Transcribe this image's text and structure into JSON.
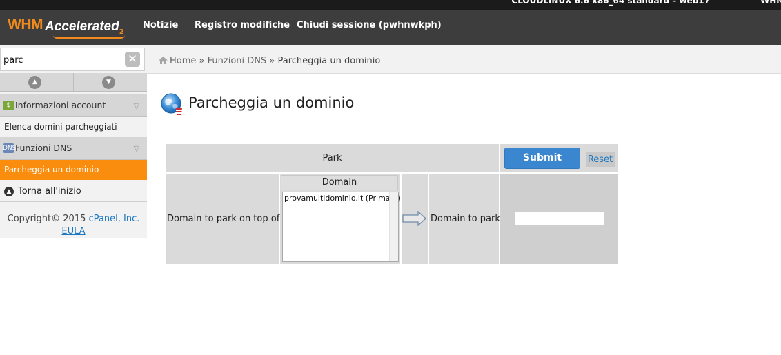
{
  "top_strip": {
    "server_text": "CLOUDLINUX 6.6 x86_64 standard – web17",
    "whm_text": "WHM"
  },
  "header": {
    "logo": {
      "whm": "WHM",
      "accelerated": "Accelerated",
      "version": "2"
    },
    "nav": [
      "Notizie",
      "Registro modifiche",
      "Chiudi sessione (pwhnwkph)"
    ]
  },
  "sidebar": {
    "search_value": "parc",
    "categories": [
      {
        "label": "Informazioni account",
        "icon": "account-info-icon"
      },
      {
        "label": "Funzioni DNS",
        "icon": "dns-icon"
      }
    ],
    "items": [
      "Elenca domini parcheggiati",
      "Parcheggia un dominio"
    ],
    "back_to_top": "Torna all'inizio",
    "copyright": "Copyright© 2015",
    "copyright_link": "cPanel, Inc.",
    "eula": "EULA"
  },
  "breadcrumb": {
    "home": "Home",
    "sep": "»",
    "section": "Funzioni DNS",
    "current": "Parcheggia un dominio"
  },
  "page": {
    "title": "Parcheggia un dominio"
  },
  "form": {
    "header_park": "Park",
    "submit": "Submit",
    "reset": "Reset",
    "label_on_top": "Domain to park on top of",
    "domain_header": "Domain",
    "domain_options": [
      "provamultidominio.it (Primary)"
    ],
    "label_to_park": "Domain to park",
    "park_value": ""
  },
  "colors": {
    "accent": "#fb8d0e",
    "header_bg": "#3d3d3d",
    "button_blue": "#3a87cf",
    "link_blue": "#1b78c2"
  }
}
